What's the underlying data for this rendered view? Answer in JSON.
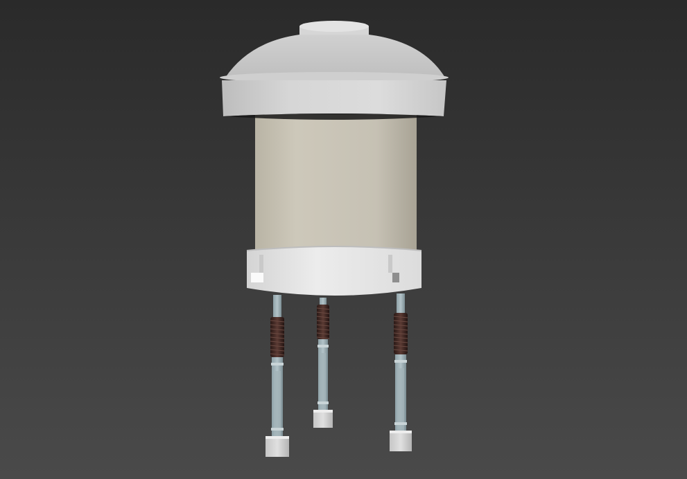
{
  "viewport": {
    "background_top": "#2a2a2a",
    "background_bottom": "#4a4a4a"
  },
  "object": {
    "name": "",
    "colors": {
      "cap": "#d4d4d4",
      "cap_shadow": "#9c9c9c",
      "body": "#c4bfb2",
      "body_shadow": "#a9a497",
      "collar": "#e6e6e6",
      "rod": "#93a6ad",
      "spring": "#3a2521",
      "foot": "#d2d2d2"
    },
    "legs": [
      {
        "id": "left"
      },
      {
        "id": "center"
      },
      {
        "id": "right"
      }
    ]
  }
}
